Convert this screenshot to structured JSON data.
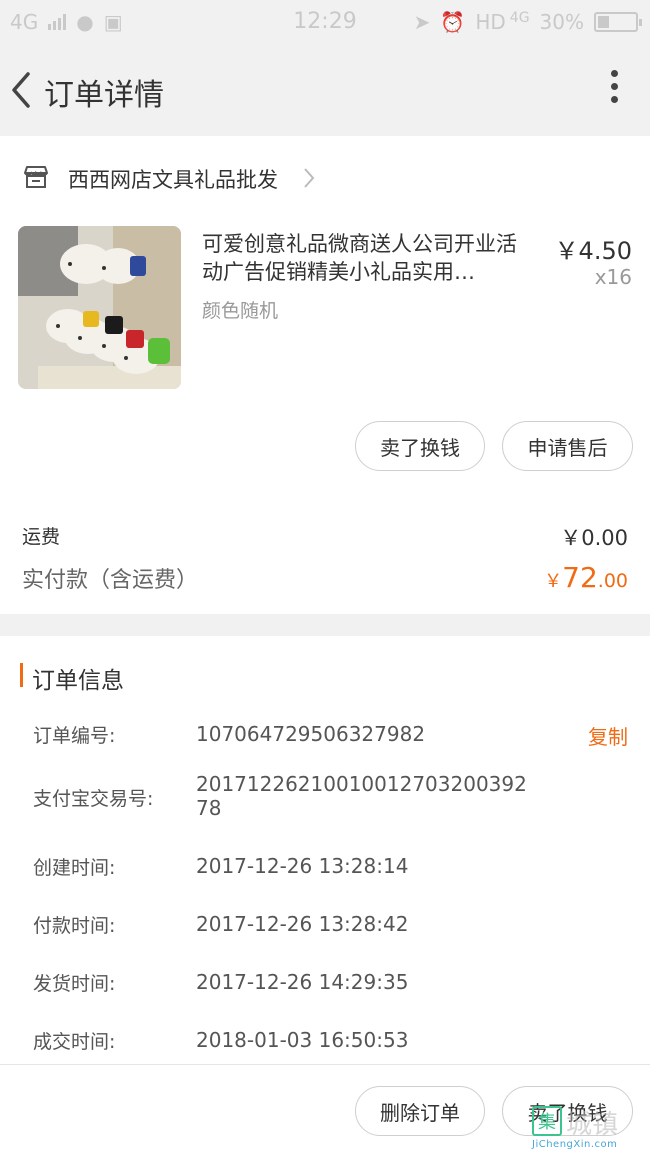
{
  "status_bar": {
    "network_left": "4G",
    "time": "12:29",
    "hd": "HD",
    "network_right": "4G",
    "battery": "30%",
    "battery_level": 0.3,
    "icons": [
      "signal-icon",
      "wechat-icon",
      "gallery-icon",
      "airplane-muted-icon",
      "alarm-icon",
      "battery-icon"
    ]
  },
  "nav": {
    "title": "订单详情"
  },
  "shop": {
    "name": "西西网店文具礼品批发"
  },
  "product": {
    "title": "可爱创意礼品微商送人公司开业活动广告促销精美小礼品实用…",
    "sku": "颜色随机",
    "price": "￥4.50",
    "quantity": "x16"
  },
  "product_actions": {
    "resell": "卖了换钱",
    "after_sale": "申请售后"
  },
  "cost": {
    "shipping_label": "运费",
    "shipping_value": "￥0.00",
    "paid_label": "实付款（含运费）",
    "paid_currency": "￥",
    "paid_int": "72",
    "paid_dec": ".00"
  },
  "order_info": {
    "title": "订单信息",
    "copy": "复制",
    "rows": [
      {
        "label": "订单编号:",
        "value": "107064729506327982"
      },
      {
        "label": "支付宝交易号:",
        "value": "2017122621001001270320039278"
      },
      {
        "label": "创建时间:",
        "value": "2017-12-26 13:28:14"
      },
      {
        "label": "付款时间:",
        "value": "2017-12-26 13:28:42"
      },
      {
        "label": "发货时间:",
        "value": "2017-12-26 14:29:35"
      },
      {
        "label": "成交时间:",
        "value": "2018-01-03 16:50:53"
      }
    ]
  },
  "bottom_actions": {
    "delete": "删除订单",
    "resell": "卖了换钱"
  },
  "watermark": {
    "box_char": "集",
    "text": "城镇",
    "url": "JiChengXin.com"
  },
  "colors": {
    "accent": "#f06b14",
    "background_band": "#f1f1f1"
  }
}
